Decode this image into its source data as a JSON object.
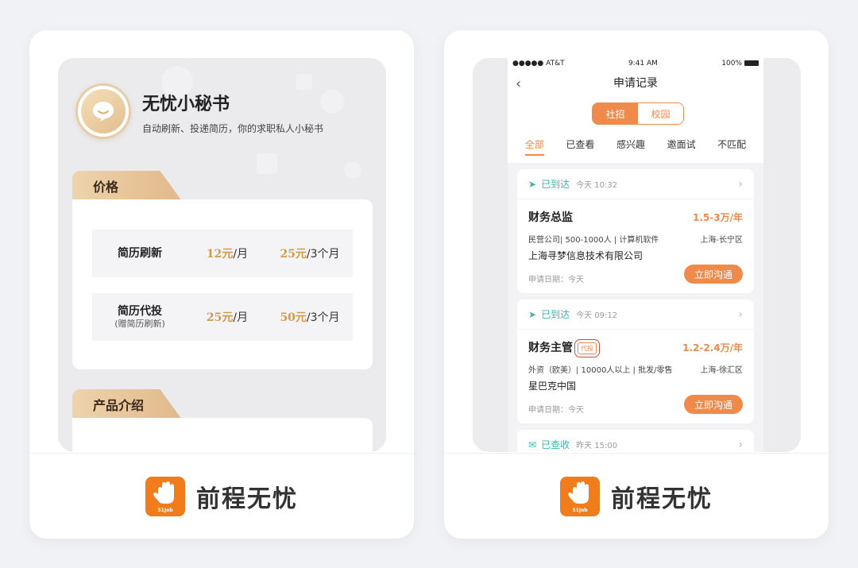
{
  "left": {
    "service": {
      "title": "无忧小秘书",
      "subtitle": "自动刷新、投递简历，你的求职私人小秘书"
    },
    "price_section": {
      "label": "价格",
      "rows": [
        {
          "name": "简历刷新",
          "note": "",
          "p1_amount": "12元",
          "p1_unit": "/月",
          "p2_amount": "25元",
          "p2_unit": "/3个月"
        },
        {
          "name": "简历代投",
          "note": "(赠简历刷新)",
          "p1_amount": "25元",
          "p1_unit": "/月",
          "p2_amount": "50元",
          "p2_unit": "/3个月"
        }
      ]
    },
    "intro_section": {
      "label": "产品介绍"
    }
  },
  "right": {
    "status_bar": {
      "carrier": "●●●●● AT&T",
      "time": "9:41 AM",
      "battery": "100%"
    },
    "nav": {
      "back": "‹",
      "title": "申请记录"
    },
    "segment": {
      "social": "社招",
      "campus": "校园"
    },
    "tabs": [
      "全部",
      "已查看",
      "感兴趣",
      "邀面试",
      "不匹配"
    ],
    "cards": [
      {
        "status": "已到达",
        "time": "今天 10:32",
        "title": "财务总监",
        "tag": "",
        "salary": "1.5-3万/年",
        "meta": "民营公司| 500-1000人 | 计算机软件",
        "location": "上海-长宁区",
        "company": "上海寻梦信息技术有限公司",
        "apply_date": "申请日期：今天",
        "button": "立即沟通"
      },
      {
        "status": "已到达",
        "time": "今天 09:12",
        "title": "财务主管",
        "tag": "代投",
        "salary": "1.2-2.4万/年",
        "meta": "外资（欧美）| 10000人以上 | 批发/零售",
        "location": "上海-徐汇区",
        "company": "星巴克中国",
        "apply_date": "申请日期：今天",
        "button": "立即沟通"
      },
      {
        "status": "已查收",
        "time": "昨天 15:00"
      }
    ]
  },
  "brand": {
    "name": "前程无忧",
    "logo_sub": "51Job"
  },
  "colors": {
    "accent": "#ef8a4b",
    "gold": "#d39a4a",
    "teal": "#39b7a8",
    "brand_orange": "#f07c1c"
  },
  "icons": {
    "service": "chat-bubble-icon",
    "sent": "paper-plane-icon",
    "read": "envelope-icon",
    "brand": "hand-icon"
  }
}
